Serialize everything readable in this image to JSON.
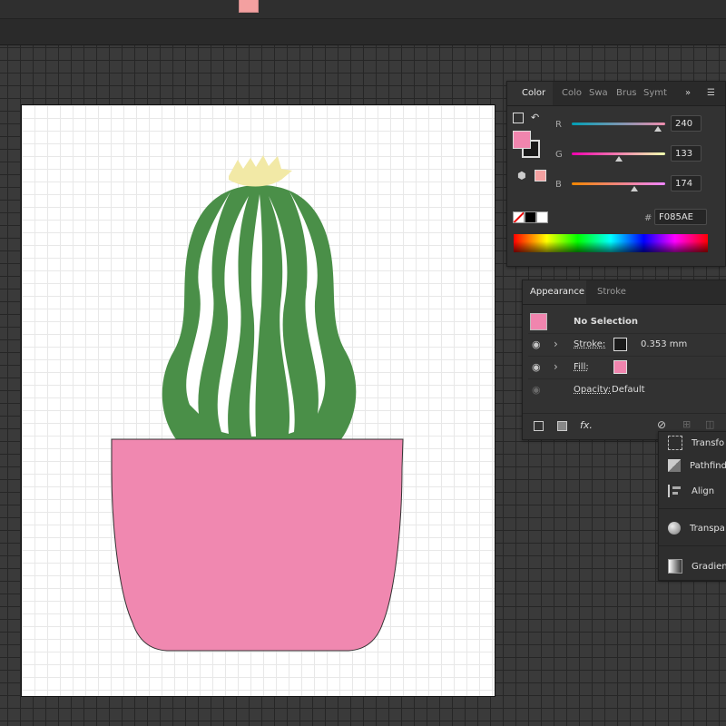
{
  "topbar": {
    "swatch_color": "#F3A0A0"
  },
  "color_panel": {
    "tabs": [
      "Color",
      "Colo",
      "Swa",
      "Brus",
      "Symt"
    ],
    "channels": [
      {
        "label": "R",
        "value": "240"
      },
      {
        "label": "G",
        "value": "133"
      },
      {
        "label": "B",
        "value": "174"
      }
    ],
    "hex_label": "#",
    "hex_value": "F085AE",
    "fill_color": "#F085AE"
  },
  "appearance_panel": {
    "tabs": [
      "Appearance",
      "Stroke"
    ],
    "selection_label": "No Selection",
    "stroke_label": "Stroke:",
    "stroke_value": "0.353 mm",
    "fill_label": "Fill:",
    "opacity_label": "Opacity:",
    "opacity_value": "Default",
    "fx_label": "fx."
  },
  "side_panels": {
    "items": [
      "Transfo",
      "Pathfinde",
      "Align",
      "Transpa",
      "Gradient"
    ]
  },
  "artwork": {
    "pot_color": "#F088B0",
    "cactus_color": "#4A8F48",
    "flower_color": "#F2E9A6"
  }
}
